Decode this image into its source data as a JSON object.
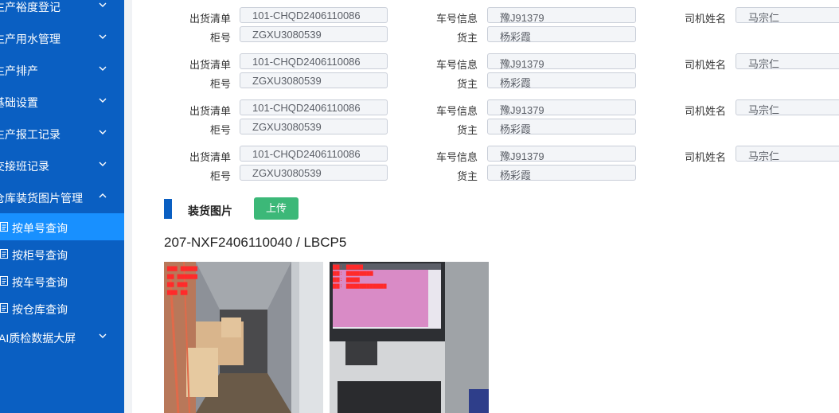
{
  "sidebar": {
    "menus": [
      {
        "label": "生产裕度登记"
      },
      {
        "label": "生产用水管理"
      },
      {
        "label": "生产排产"
      },
      {
        "label": "基础设置"
      },
      {
        "label": "生产报工记录"
      },
      {
        "label": "交接班记录"
      },
      {
        "label": "仓库装货图片管理"
      }
    ],
    "submenu": [
      {
        "label": "按单号查询",
        "active": true
      },
      {
        "label": "按柜号查询"
      },
      {
        "label": "按车号查询"
      },
      {
        "label": "按仓库查询"
      }
    ],
    "last_menu": {
      "label": "AI质检数据大屏"
    }
  },
  "labels": {
    "shipping_list": "出货清单",
    "container_no": "柜号",
    "vehicle_info": "车号信息",
    "owner": "货主",
    "driver_name": "司机姓名"
  },
  "records": [
    {
      "shipping_list": "101-CHQD2406110086",
      "container_no": "ZGXU3080539",
      "vehicle_info": "豫J91379",
      "owner": "杨彩霞",
      "driver_name": "马宗仁"
    },
    {
      "shipping_list": "101-CHQD2406110086",
      "container_no": "ZGXU3080539",
      "vehicle_info": "豫J91379",
      "owner": "杨彩霞",
      "driver_name": "马宗仁"
    },
    {
      "shipping_list": "101-CHQD2406110086",
      "container_no": "ZGXU3080539",
      "vehicle_info": "豫J91379",
      "owner": "杨彩霞",
      "driver_name": "马宗仁"
    },
    {
      "shipping_list": "101-CHQD2406110086",
      "container_no": "ZGXU3080539",
      "vehicle_info": "豫J91379",
      "owner": "杨彩霞",
      "driver_name": "马宗仁"
    }
  ],
  "photos_section": {
    "title": "装货图片",
    "upload_label": "上传",
    "caption": "207-NXF2406110040 / LBCP5"
  },
  "colors": {
    "sidebar_bg": "#0a5fc2",
    "sidebar_active": "#1890ff",
    "upload_green": "#3cb878"
  },
  "icons": {
    "menu_chevron": "chevron-down-icon",
    "expanded_chevron": "chevron-up-icon",
    "sub_item": "document-icon"
  }
}
